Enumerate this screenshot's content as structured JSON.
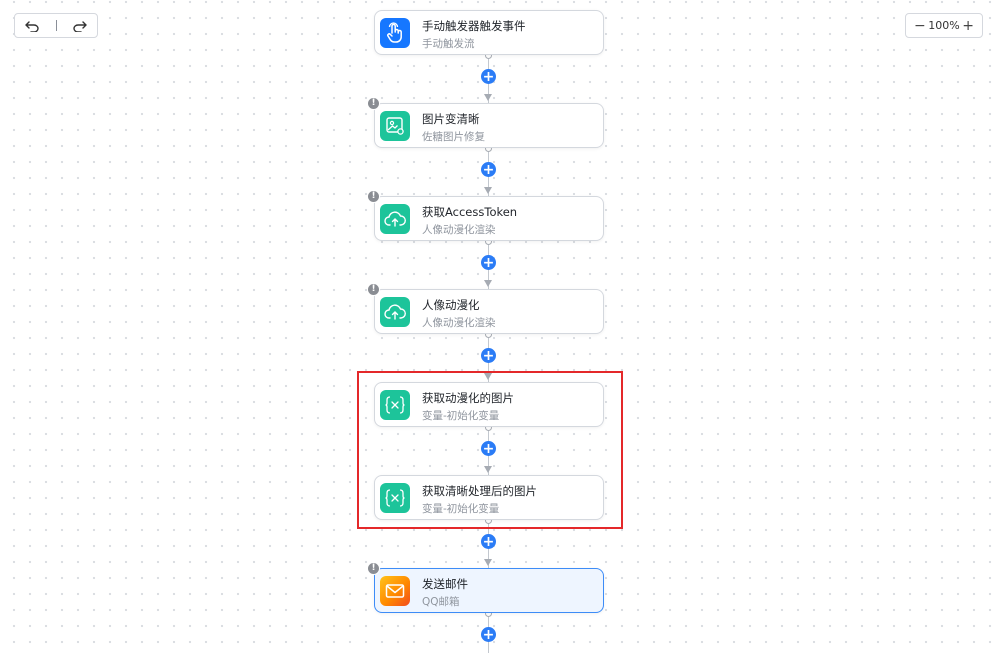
{
  "toolbar": {
    "undo_icon": "undo-icon",
    "redo_icon": "redo-icon",
    "zoom_out": "−",
    "zoom_level": "100%",
    "zoom_in": "+"
  },
  "colors": {
    "accent": "#2b7cf6",
    "trigger_icon_bg": "#1677ff",
    "step_icon_bg": "#1dc49a",
    "selection": "#e4282a",
    "warning": "#8a8d93"
  },
  "nodes": [
    {
      "title": "手动触发器触发事件",
      "subtitle": "手动触发流",
      "icon": "hand-pointer-icon",
      "warning": false
    },
    {
      "title": "图片变清晰",
      "subtitle": "佐糖图片修复",
      "icon": "image-enhance-icon",
      "warning": true
    },
    {
      "title": "获取AccessToken",
      "subtitle": "人像动漫化渲染",
      "icon": "cloud-upload-icon",
      "warning": true
    },
    {
      "title": "人像动漫化",
      "subtitle": "人像动漫化渲染",
      "icon": "cloud-upload-icon",
      "warning": true
    },
    {
      "title": "获取动漫化的图片",
      "subtitle": "变量-初始化变量",
      "icon": "variable-icon",
      "warning": false
    },
    {
      "title": "获取清晰处理后的图片",
      "subtitle": "变量-初始化变量",
      "icon": "variable-icon",
      "warning": false
    },
    {
      "title": "发送邮件",
      "subtitle": "QQ邮箱",
      "icon": "mail-icon",
      "warning": true
    }
  ],
  "warning_glyph": "!",
  "add_step_glyph": "+"
}
